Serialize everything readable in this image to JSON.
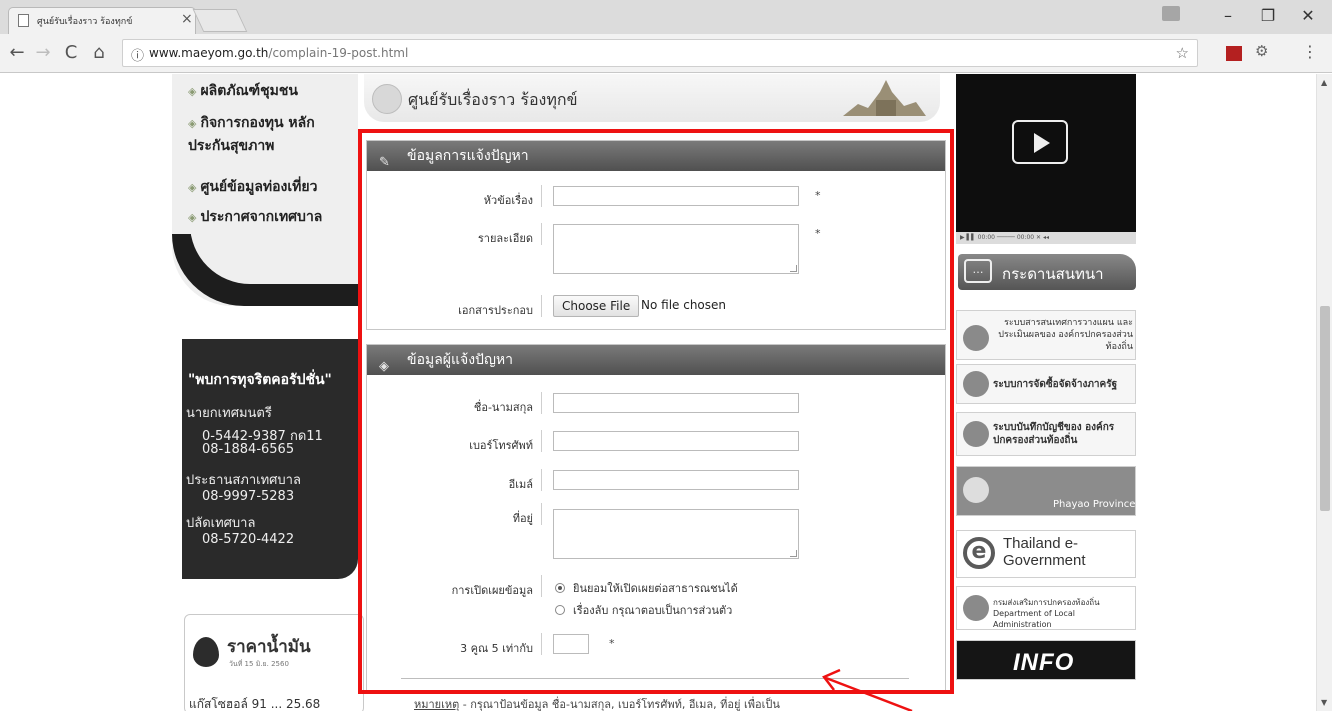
{
  "browser": {
    "tab_title": "ศูนย์รับเรื่องราว ร้องทุกข์",
    "tab_close": "×",
    "url_host": "www.maeyom.go.th",
    "url_path": "/complain-19-post.html",
    "window_buttons": {
      "minimize": "–",
      "maximize": "❐",
      "close": "✕"
    },
    "nav": {
      "back": "←",
      "forward": "→",
      "reload": "C",
      "home": "⌂",
      "info": "ⓘ",
      "star": "☆",
      "menu": "⋮"
    }
  },
  "sidebar": {
    "menu_items": [
      "ผลิตภัณฑ์ชุมชน",
      "กิจการกองทุน หลักประกันสุขภาพ",
      "ศูนย์ข้อมูลท่องเที่ยว",
      "ประกาศจากเทศบาล"
    ],
    "contact": {
      "headline": "\"พบการทุจริตคอรัปชั่น\"",
      "lines": [
        "นายกเทศมนตรี",
        "0-5442-9387 กด11",
        "08-1884-6565",
        "ประธานสภาเทศบาล",
        "08-9997-5283",
        "ปลัดเทศบาล",
        "08-5720-4422"
      ]
    },
    "oil": {
      "title": "ราคาน้ำมัน",
      "date": "วันที่ 15 มิ.ย. 2560",
      "first_row": "แก๊สโซฮอล์ 91    ... 25.68"
    }
  },
  "main": {
    "banner_title": "ศูนย์รับเรื่องราว ร้องทุกข์",
    "complaint_section": {
      "title": "ข้อมูลการแจ้งปัญหา",
      "subject_label": "หัวข้อเรื่อง",
      "detail_label": "รายละเอียด",
      "attachment_label": "เอกสารประกอบ",
      "file_button": "Choose File",
      "file_status": "No file chosen",
      "required_mark": "*"
    },
    "reporter_section": {
      "title": "ข้อมูลผู้แจ้งปัญหา",
      "name_label": "ชื่อ-นามสกุล",
      "phone_label": "เบอร์โทรศัพท์",
      "email_label": "อีเมล์",
      "address_label": "ที่อยู่",
      "disclosure_label": "การเปิดเผยข้อมูล",
      "disclosure_options": [
        "ยินยอมให้เปิดเผยต่อสาธารณชนได้",
        "เรื่องลับ กรุณาตอบเป็นการส่วนตัว"
      ],
      "disclosure_selected": 0,
      "captcha_label": "3 คูณ 5 เท่ากับ",
      "required_mark": "*"
    },
    "note_label": "หมายเหตุ",
    "note_text": " - กรุณาป้อนข้อมูล ชื่อ-นามสกุล, เบอร์โทรศัพท์, อีเมล, ที่อยู่ เพื่อเป็น"
  },
  "rightbar": {
    "video_time": "▶ ▌▌ 00:00 ───── 00:00  ✕  ◂◂",
    "board_title": "กระดานสนทนา",
    "banners": [
      "ระบบสารสนเทศการวางแผน และประเมินผลของ องค์กรปกครองส่วนท้องถิ่น",
      "ระบบการจัดซื้อจัดจ้างภาครัฐ",
      "ระบบบันทึกบัญชีของ องค์กรปกครองส่วนท้องถิ่น",
      "Phayao Province",
      "Thailand e-Government",
      "กรมส่งเสริมการปกครองท้องถิ่น Department of Local Administration",
      "INFO"
    ]
  },
  "colors": {
    "highlight_box": "#ee1111",
    "section_header": "#5a5a5a"
  }
}
